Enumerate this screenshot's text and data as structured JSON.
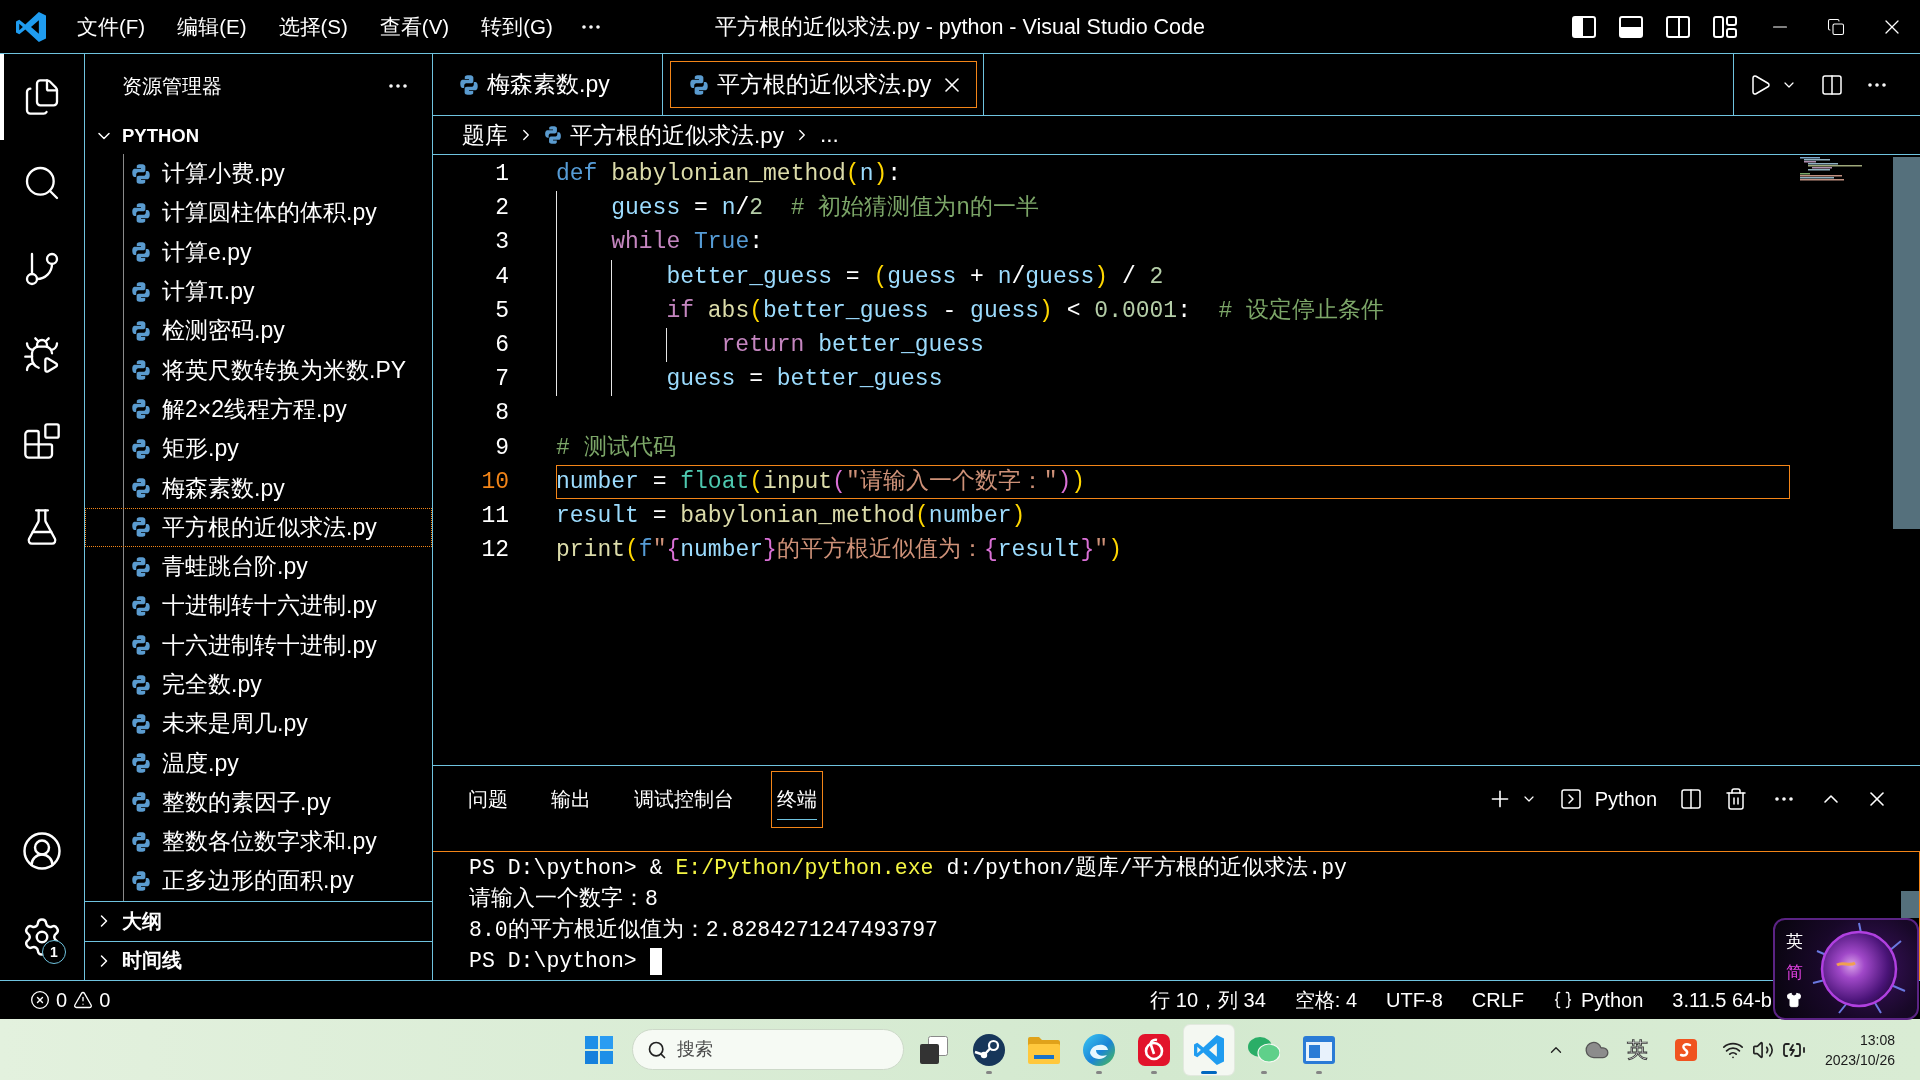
{
  "title_bar": {
    "menus": [
      "文件(F)",
      "编辑(E)",
      "选择(S)",
      "查看(V)",
      "转到(G)"
    ],
    "title": "平方根的近似求法.py - python - Visual Studio Code",
    "layout_toggles": [
      {
        "on": true
      },
      {
        "on": true
      },
      {
        "on": false
      }
    ]
  },
  "activity_bar": {
    "items": [
      {
        "selected": true
      },
      {
        "selected": false
      },
      {
        "selected": false
      },
      {
        "selected": false
      },
      {
        "selected": false
      },
      {
        "selected": false
      }
    ],
    "settings_badge": "1"
  },
  "sidebar": {
    "title": "资源管理器",
    "folder": {
      "name": "PYTHON",
      "expanded": true,
      "files": [
        {
          "name": "计算小费.py",
          "selected": false
        },
        {
          "name": "计算圆柱体的体积.py",
          "selected": false
        },
        {
          "name": "计算e.py",
          "selected": false
        },
        {
          "name": "计算π.py",
          "selected": false
        },
        {
          "name": "检测密码.py",
          "selected": false
        },
        {
          "name": "将英尺数转换为米数.PY",
          "selected": false
        },
        {
          "name": "解2×2线程方程.py",
          "selected": false
        },
        {
          "name": "矩形.py",
          "selected": false
        },
        {
          "name": "梅森素数.py",
          "selected": false
        },
        {
          "name": "平方根的近似求法.py",
          "selected": true
        },
        {
          "name": "青蛙跳台阶.py",
          "selected": false
        },
        {
          "name": "十进制转十六进制.py",
          "selected": false
        },
        {
          "name": "十六进制转十进制.py",
          "selected": false
        },
        {
          "name": "完全数.py",
          "selected": false
        },
        {
          "name": "未来是周几.py",
          "selected": false
        },
        {
          "name": "温度.py",
          "selected": false
        },
        {
          "name": "整数的素因子.py",
          "selected": false
        },
        {
          "name": "整数各位数字求和.py",
          "selected": false
        },
        {
          "name": "正多边形的面积.py",
          "selected": false
        }
      ]
    },
    "sections": [
      {
        "name": "大纲",
        "expanded": false
      },
      {
        "name": "时间线",
        "expanded": false
      }
    ]
  },
  "editor": {
    "tabs": [
      {
        "name": "梅森素数.py",
        "selected": false
      },
      {
        "name": "平方根的近似求法.py",
        "selected": true
      }
    ],
    "breadcrumb": [
      {
        "text": "题库",
        "kind": "folder"
      },
      {
        "text": "平方根的近似求法.py",
        "kind": "file"
      },
      {
        "text": "...",
        "kind": "symbol"
      }
    ],
    "lines": [
      {
        "number": "1",
        "current": false,
        "tokens": [
          {
            "text": "def ",
            "kind": "keyword"
          },
          {
            "text": "babylonian_method",
            "kind": "function"
          },
          {
            "text": "(",
            "kind": "bracket1"
          },
          {
            "text": "n",
            "kind": "variable"
          },
          {
            "text": ")",
            "kind": "bracket1"
          },
          {
            "text": ":",
            "kind": "plain"
          }
        ],
        "children": [
          {
            "number": "2",
            "current": false,
            "tokens": [
              {
                "text": "guess",
                "kind": "variable"
              },
              {
                "text": " = ",
                "kind": "plain"
              },
              {
                "text": "n",
                "kind": "variable"
              },
              {
                "text": "/",
                "kind": "plain"
              },
              {
                "text": "2",
                "kind": "number"
              },
              {
                "text": "  # 初始猜测值为n的一半",
                "kind": "comment"
              }
            ]
          },
          {
            "number": "3",
            "current": false,
            "tokens": [
              {
                "text": "while ",
                "kind": "control"
              },
              {
                "text": "True",
                "kind": "keyword"
              },
              {
                "text": ":",
                "kind": "plain"
              }
            ],
            "children": [
              {
                "number": "4",
                "current": false,
                "tokens": [
                  {
                    "text": "better_guess",
                    "kind": "variable"
                  },
                  {
                    "text": " = ",
                    "kind": "plain"
                  },
                  {
                    "text": "(",
                    "kind": "bracket1"
                  },
                  {
                    "text": "guess",
                    "kind": "variable"
                  },
                  {
                    "text": " + ",
                    "kind": "plain"
                  },
                  {
                    "text": "n",
                    "kind": "variable"
                  },
                  {
                    "text": "/",
                    "kind": "plain"
                  },
                  {
                    "text": "guess",
                    "kind": "variable"
                  },
                  {
                    "text": ")",
                    "kind": "bracket1"
                  },
                  {
                    "text": " / ",
                    "kind": "plain"
                  },
                  {
                    "text": "2",
                    "kind": "number"
                  }
                ]
              },
              {
                "number": "5",
                "current": false,
                "tokens": [
                  {
                    "text": "if ",
                    "kind": "control"
                  },
                  {
                    "text": "abs",
                    "kind": "function"
                  },
                  {
                    "text": "(",
                    "kind": "bracket1"
                  },
                  {
                    "text": "better_guess",
                    "kind": "variable"
                  },
                  {
                    "text": " - ",
                    "kind": "plain"
                  },
                  {
                    "text": "guess",
                    "kind": "variable"
                  },
                  {
                    "text": ")",
                    "kind": "bracket1"
                  },
                  {
                    "text": " < ",
                    "kind": "plain"
                  },
                  {
                    "text": "0.0001",
                    "kind": "number"
                  },
                  {
                    "text": ":",
                    "kind": "plain"
                  },
                  {
                    "text": "  # 设定停止条件",
                    "kind": "comment"
                  }
                ],
                "children": [
                  {
                    "number": "6",
                    "current": false,
                    "tokens": [
                      {
                        "text": "return ",
                        "kind": "control"
                      },
                      {
                        "text": "better_guess",
                        "kind": "variable"
                      }
                    ]
                  }
                ]
              },
              {
                "number": "7",
                "current": false,
                "tokens": [
                  {
                    "text": "guess",
                    "kind": "variable"
                  },
                  {
                    "text": " = ",
                    "kind": "plain"
                  },
                  {
                    "text": "better_guess",
                    "kind": "variable"
                  }
                ]
              }
            ]
          }
        ]
      },
      {
        "number": "8",
        "current": false
      },
      {
        "number": "9",
        "current": false,
        "tokens": [
          {
            "text": "# 测试代码",
            "kind": "comment"
          }
        ]
      },
      {
        "number": "10",
        "current": true,
        "tokens": [
          {
            "text": "number",
            "kind": "variable"
          },
          {
            "text": " = ",
            "kind": "plain"
          },
          {
            "text": "float",
            "kind": "class"
          },
          {
            "text": "(",
            "kind": "bracket1"
          },
          {
            "text": "input",
            "kind": "function"
          },
          {
            "text": "(",
            "kind": "bracket2"
          },
          {
            "text": "\"请输入一个数字：\"",
            "kind": "string"
          },
          {
            "text": ")",
            "kind": "bracket2"
          },
          {
            "text": ")",
            "kind": "bracket1"
          }
        ]
      },
      {
        "number": "11",
        "current": false,
        "tokens": [
          {
            "text": "result",
            "kind": "variable"
          },
          {
            "text": " = ",
            "kind": "plain"
          },
          {
            "text": "babylonian_method",
            "kind": "function"
          },
          {
            "text": "(",
            "kind": "bracket1"
          },
          {
            "text": "number",
            "kind": "variable"
          },
          {
            "text": ")",
            "kind": "bracket1"
          }
        ]
      },
      {
        "number": "12",
        "current": false,
        "tokens": [
          {
            "text": "print",
            "kind": "function"
          },
          {
            "text": "(",
            "kind": "bracket1"
          },
          {
            "text": "f",
            "kind": "keyword"
          },
          {
            "text": "\"",
            "kind": "string"
          },
          {
            "text": "{",
            "kind": "bracket2"
          },
          {
            "text": "number",
            "kind": "variable"
          },
          {
            "text": "}",
            "kind": "bracket2"
          },
          {
            "text": "的平方根近似值为：",
            "kind": "string"
          },
          {
            "text": "{",
            "kind": "bracket2"
          },
          {
            "text": "result",
            "kind": "variable"
          },
          {
            "text": "}",
            "kind": "bracket2"
          },
          {
            "text": "\"",
            "kind": "string"
          },
          {
            "text": ")",
            "kind": "bracket1"
          }
        ]
      }
    ]
  },
  "panel": {
    "tabs": [
      {
        "label": "问题",
        "selected": false
      },
      {
        "label": "输出",
        "selected": false
      },
      {
        "label": "调试控制台",
        "selected": false
      },
      {
        "label": "终端",
        "selected": true
      }
    ],
    "profile": "Python",
    "terminal": {
      "lines": [
        {
          "cursor": false,
          "tokens": [
            {
              "text": "PS D:\\python> & ",
              "kind": "plain"
            },
            {
              "text": "E:/Python/python.exe",
              "kind": "command"
            },
            {
              "text": " d:/python/题库/平方根的近似求法.py",
              "kind": "plain"
            }
          ]
        },
        {
          "cursor": false,
          "tokens": [
            {
              "text": "请输入一个数字：8",
              "kind": "plain"
            }
          ]
        },
        {
          "cursor": false,
          "tokens": [
            {
              "text": "8.0的平方根近似值为：2.8284271247493797",
              "kind": "plain"
            }
          ]
        },
        {
          "cursor": true,
          "tokens": [
            {
              "text": "PS D:\\python> ",
              "kind": "plain"
            }
          ]
        }
      ]
    }
  },
  "status_bar": {
    "errors": "0",
    "warnings": "0",
    "items": [
      {
        "text": "行 10，列 34",
        "kind": "plain"
      },
      {
        "text": "空格: 4",
        "kind": "plain"
      },
      {
        "text": "UTF-8",
        "kind": "plain"
      },
      {
        "text": "CRLF",
        "kind": "plain"
      },
      {
        "text": "Python",
        "kind": "language"
      },
      {
        "text": "3.11.5 64-b",
        "kind": "plain"
      }
    ]
  },
  "ime_toolbar": {
    "mode": "英",
    "script": "简"
  },
  "taskbar": {
    "search": {
      "placeholder": "搜索"
    },
    "apps": [
      {
        "running": false,
        "selected": false
      },
      {
        "running": true,
        "selected": false
      },
      {
        "running": false,
        "selected": false
      },
      {
        "running": true,
        "selected": false
      },
      {
        "running": true,
        "selected": false
      },
      {
        "running": true,
        "selected": true
      },
      {
        "running": true,
        "selected": false
      },
      {
        "running": true,
        "selected": false
      }
    ],
    "tray": {
      "ime_mode": "英"
    },
    "clock": {
      "time": "13:08",
      "date": "2023/10/26"
    }
  }
}
